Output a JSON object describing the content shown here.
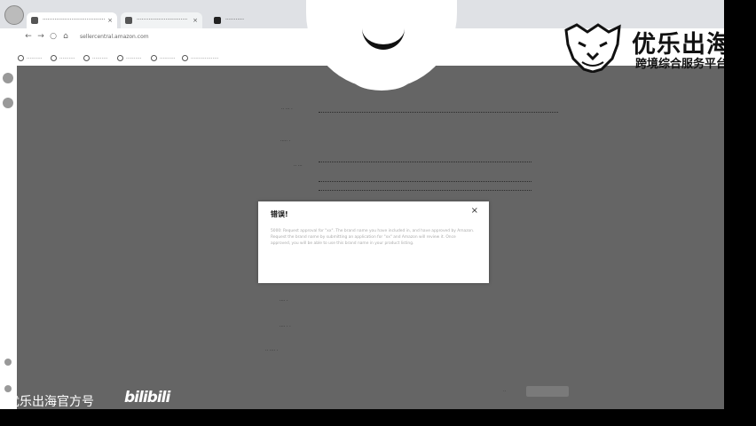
{
  "browser": {
    "tabs": [
      {
        "label": "·····································"
      },
      {
        "label": "······························"
      },
      {
        "label": "···········"
      }
    ],
    "url": "sellercentral.amazon.com",
    "bookmarks": [
      {
        "label": "··········"
      },
      {
        "label": "··········"
      },
      {
        "label": "··········"
      },
      {
        "label": "··········"
      },
      {
        "label": "··········"
      },
      {
        "label": "··················"
      }
    ]
  },
  "modal": {
    "title": "错误!",
    "close_glyph": "×",
    "body": "5000: Request approval for \"xx\". The brand name you have included in, and have approved by Amazon. Request the brand name by submitting an application for \"xx\" and Amazon will review it. Once approved, you will be able to use this brand name in your product listing."
  },
  "watermark": {
    "brand": "优乐出海",
    "subtitle": "跨境综合服务平台",
    "channel": "优乐出海官方号",
    "platform": "bilibili"
  }
}
